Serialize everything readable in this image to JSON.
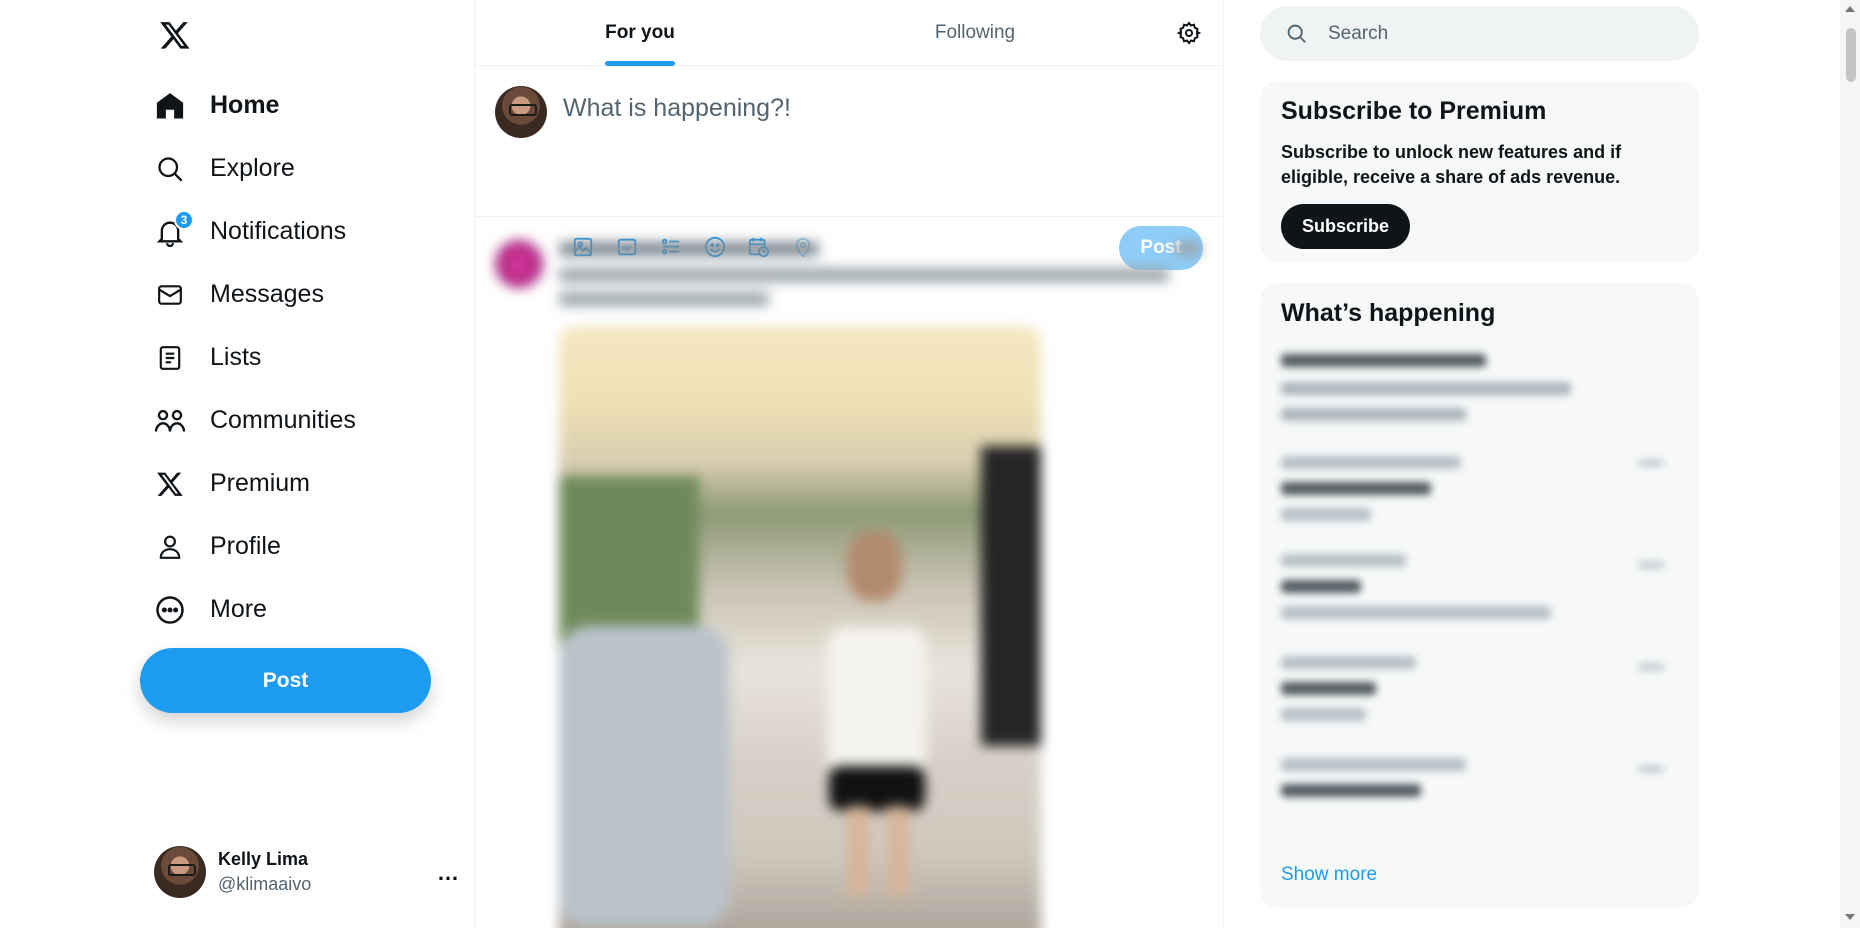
{
  "nav": {
    "items": [
      {
        "label": "Home",
        "icon": "home-icon"
      },
      {
        "label": "Explore",
        "icon": "search-icon"
      },
      {
        "label": "Notifications",
        "icon": "bell-icon",
        "badge": "3"
      },
      {
        "label": "Messages",
        "icon": "envelope-icon"
      },
      {
        "label": "Lists",
        "icon": "list-icon"
      },
      {
        "label": "Communities",
        "icon": "people-icon"
      },
      {
        "label": "Premium",
        "icon": "x-logo-icon"
      },
      {
        "label": "Profile",
        "icon": "person-icon"
      },
      {
        "label": "More",
        "icon": "more-circle-icon"
      }
    ],
    "post_label": "Post"
  },
  "account": {
    "name": "Kelly Lima",
    "handle": "@klimaaivo",
    "more": "…"
  },
  "tabs": [
    {
      "label": "For you",
      "active": true
    },
    {
      "label": "Following",
      "active": false
    }
  ],
  "composer": {
    "placeholder": "What is happening?!",
    "post_label": "Post",
    "tools": [
      "image-icon",
      "gif-icon",
      "poll-icon",
      "emoji-icon",
      "schedule-icon",
      "location-icon"
    ]
  },
  "search": {
    "placeholder": "Search"
  },
  "premium": {
    "title": "Subscribe to Premium",
    "text": "Subscribe to unlock new features and if eligible, receive a share of ads revenue.",
    "button": "Subscribe"
  },
  "happening": {
    "title": "What’s happening",
    "show_more": "Show more"
  },
  "colors": {
    "accent": "#1d9bf0",
    "text": "#0f1419",
    "muted": "#536471",
    "card": "#f7f9f9"
  }
}
